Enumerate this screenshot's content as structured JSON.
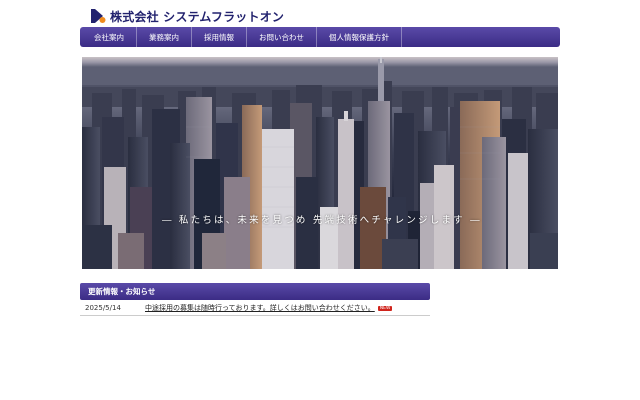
{
  "header": {
    "company_name": "株式会社 システムフラットオン",
    "brand_color": "#22226e"
  },
  "nav": {
    "items": [
      {
        "label": "会社案内"
      },
      {
        "label": "業務案内"
      },
      {
        "label": "採用情報"
      },
      {
        "label": "お問い合わせ"
      },
      {
        "label": "個人情報保護方針"
      }
    ],
    "color": "#4a3a98"
  },
  "hero": {
    "tagline": "― 私たちは、未来を見つめ 先端技術へチャレンジします ―"
  },
  "news": {
    "title": "更新情報・お知らせ",
    "items": [
      {
        "date": "2025/5/14",
        "text": "中途採用の募集は随時行っております。詳しくはお問い合わせください。",
        "badge": "NEW"
      }
    ]
  }
}
